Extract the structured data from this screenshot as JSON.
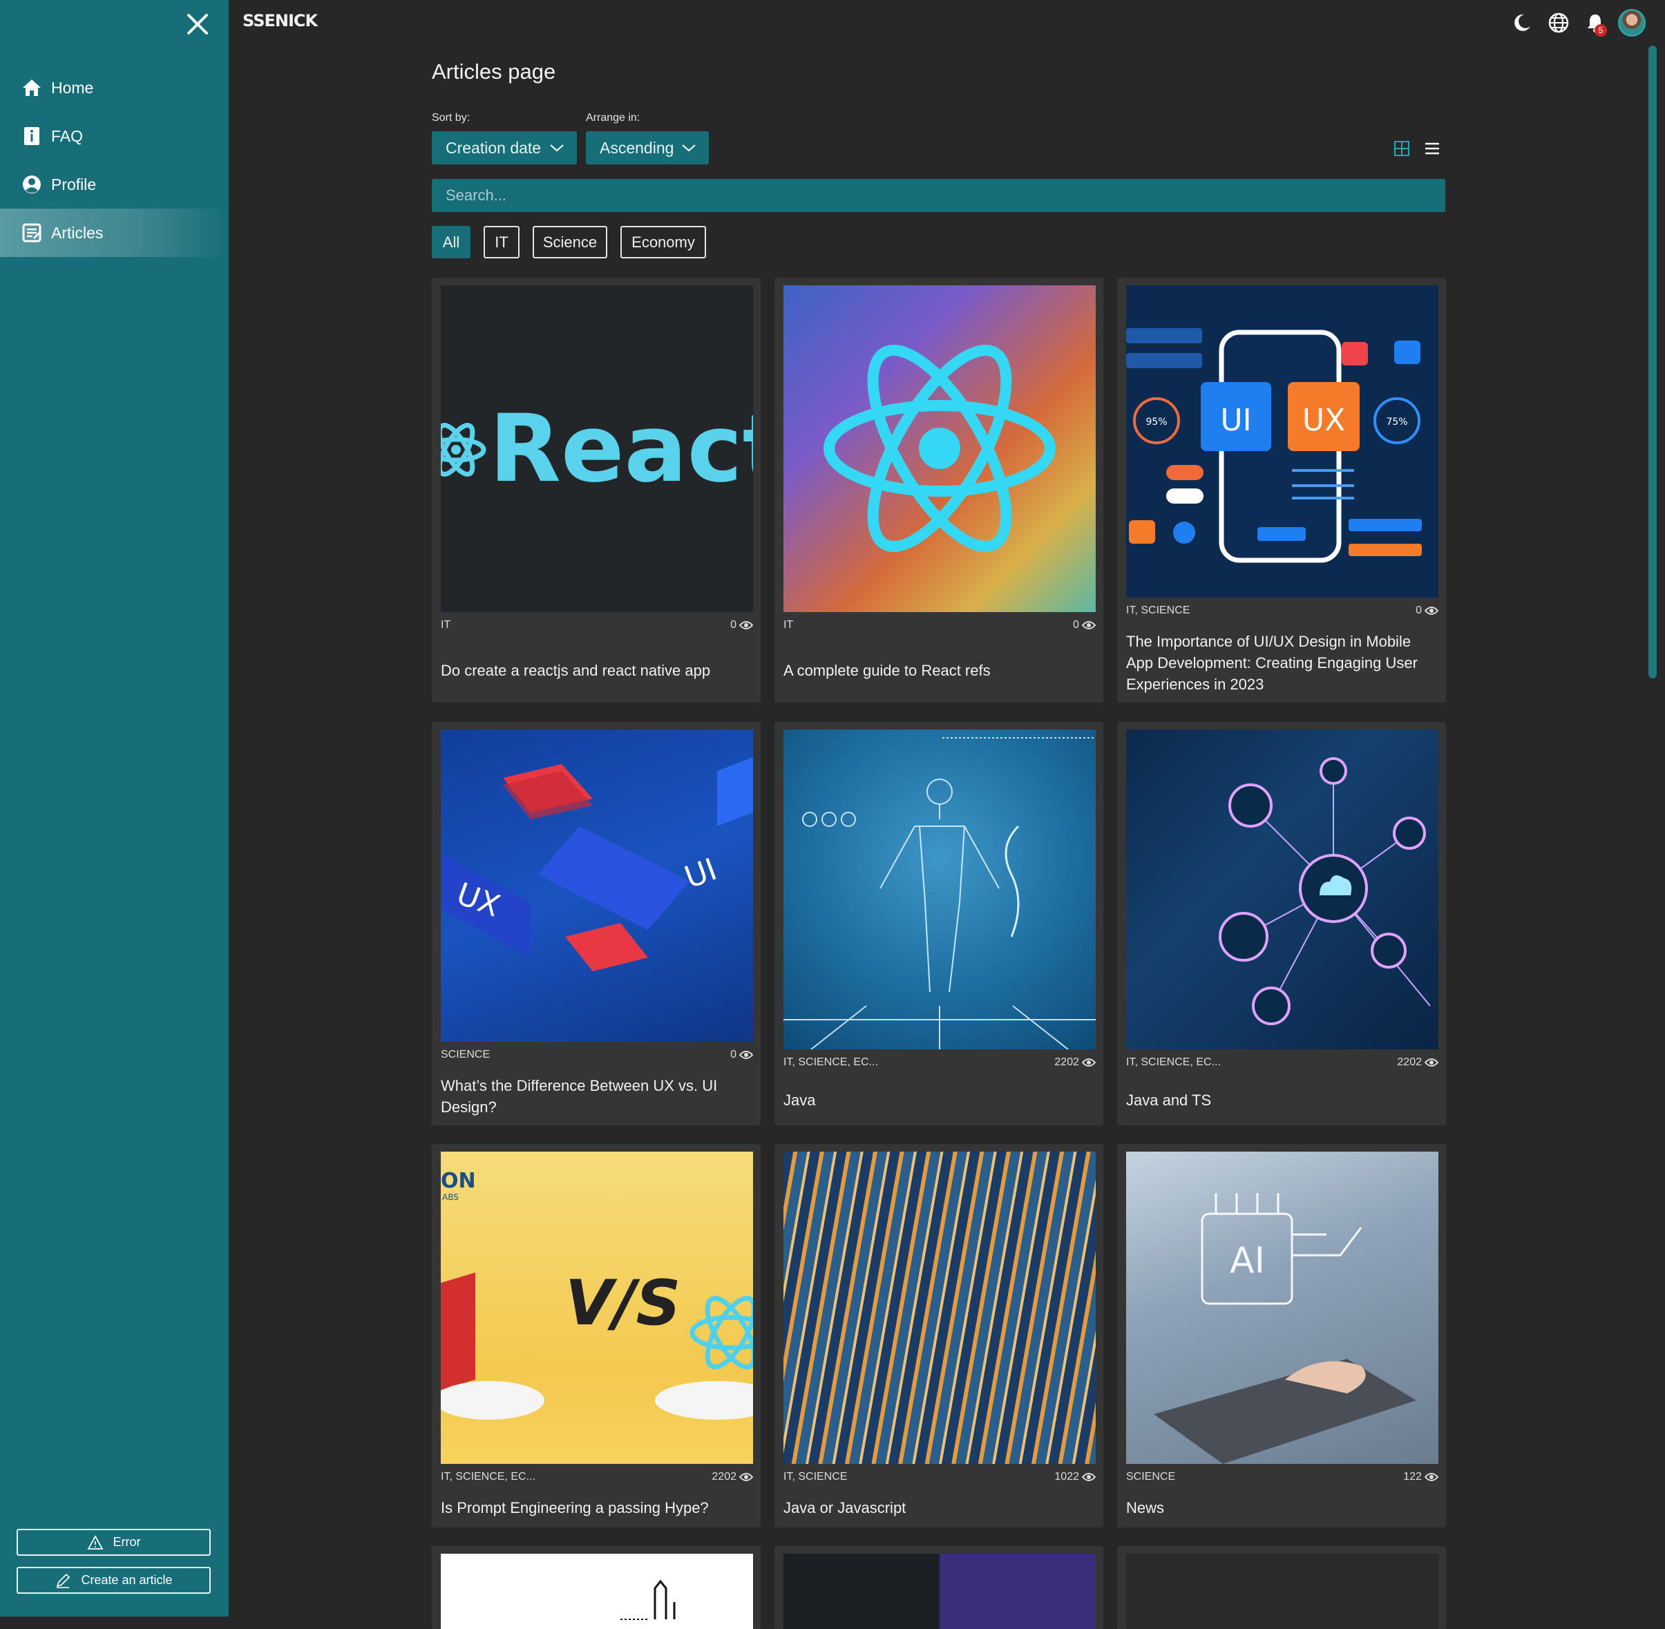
{
  "brand": "SSENICK",
  "sidebar": {
    "items": [
      {
        "label": "Home",
        "icon": "home-icon"
      },
      {
        "label": "FAQ",
        "icon": "info-icon"
      },
      {
        "label": "Profile",
        "icon": "user-circle-icon"
      },
      {
        "label": "Articles",
        "icon": "article-icon",
        "active": true
      }
    ],
    "error_button": "Error",
    "create_button": "Create an article"
  },
  "topbar": {
    "notification_count": "5"
  },
  "page": {
    "title": "Articles page",
    "sort_label": "Sort by:",
    "sort_value": "Creation date",
    "arrange_label": "Arrange in:",
    "arrange_value": "Ascending",
    "search_placeholder": "Search...",
    "filters": [
      "All",
      "IT",
      "Science",
      "Economy"
    ],
    "active_filter": "All"
  },
  "articles": [
    {
      "tags": "IT",
      "views": "0",
      "title": "Do create a reactjs and react native app",
      "image": "react-logo-dark"
    },
    {
      "tags": "IT",
      "views": "0",
      "title": "A complete guide to React refs",
      "image": "react-atom-gradient"
    },
    {
      "tags": "IT, SCIENCE",
      "views": "0",
      "title": "The Importance of UI/UX Design in Mobile App Development: Creating Engaging User Experiences in 2023",
      "image": "ui-ux-phone"
    },
    {
      "tags": "SCIENCE",
      "views": "0",
      "title": "What’s the Difference Between UX vs. UI Design?",
      "image": "ux-ui-isometric"
    },
    {
      "tags": "IT, SCIENCE, EC...",
      "views": "2202",
      "title": "Java",
      "image": "digital-human"
    },
    {
      "tags": "IT, SCIENCE, EC...",
      "views": "2202",
      "title": "Java and TS",
      "image": "network-nodes"
    },
    {
      "tags": "IT, SCIENCE, EC...",
      "views": "2202",
      "title": "Is Prompt Engineering a passing Hype?",
      "image": "angular-vs-react"
    },
    {
      "tags": "IT, SCIENCE",
      "views": "1022",
      "title": "Java or Javascript",
      "image": "city-night"
    },
    {
      "tags": "SCIENCE",
      "views": "122",
      "title": "News",
      "image": "ai-laptop"
    }
  ],
  "colors": {
    "accent": "#176e78",
    "background": "#272727",
    "card": "#353535"
  }
}
